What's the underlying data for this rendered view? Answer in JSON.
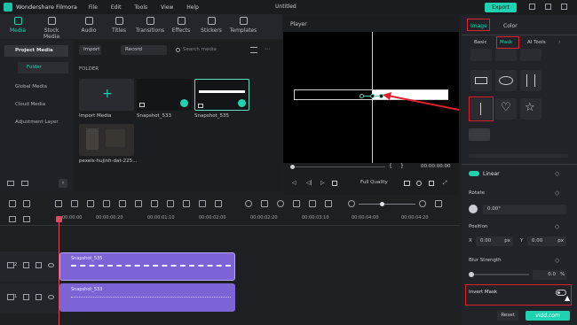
{
  "app": {
    "title": "Wondershare Filmora",
    "doc_title": "Untitled",
    "export_label": "Export",
    "menu": [
      "File",
      "Edit",
      "Tools",
      "View",
      "Help"
    ]
  },
  "toolbar": {
    "tabs": [
      "Media",
      "Stock Media",
      "Audio",
      "Titles",
      "Transitions",
      "Effects",
      "Stickers",
      "Templates"
    ]
  },
  "sidebar": {
    "items": [
      "Project Media",
      "Folder",
      "Global Media",
      "Cloud Media",
      "Adjustment Layer"
    ]
  },
  "media": {
    "import_label": "Import",
    "record_label": "Record",
    "search_placeholder": "Search media",
    "folder_label": "FOLDER",
    "items": [
      {
        "label": "Import Media"
      },
      {
        "label": "Snapshot_533"
      },
      {
        "label": "Snapshot_535"
      },
      {
        "label": "pexels-hujinh-dat-225..."
      }
    ]
  },
  "player": {
    "label": "Player",
    "timecode": "00:00:00:00",
    "quality": "Full Quality"
  },
  "panel": {
    "tabs": [
      "Image",
      "Color"
    ],
    "subtabs": [
      "Basic",
      "Mask",
      "AI Tools"
    ],
    "linear_label": "Linear",
    "rotate_label": "Rotate",
    "rotate_value": "0.00°",
    "position_label": "Position",
    "x_label": "X",
    "x_value": "0.00",
    "x_unit": "px",
    "y_label": "Y",
    "y_value": "0.00",
    "y_unit": "px",
    "blur_label": "Blur Strength",
    "blur_value": "0.0",
    "blur_unit": "%",
    "invert_label": "Invert Mask",
    "reset_label": "Reset"
  },
  "timeline": {
    "ruler": [
      "00:00:00",
      "00:00:00:20",
      "00:00:01:10",
      "00:00:02:00",
      "00:00:02:20",
      "00:00:03:10",
      "00:00:04:00",
      "00:00:04:20"
    ],
    "clips": [
      {
        "label": "Snapshot_535"
      },
      {
        "label": "Snapshot_533"
      }
    ],
    "track_numbers": [
      "2",
      "1"
    ]
  },
  "watermark": "vidd.com"
}
